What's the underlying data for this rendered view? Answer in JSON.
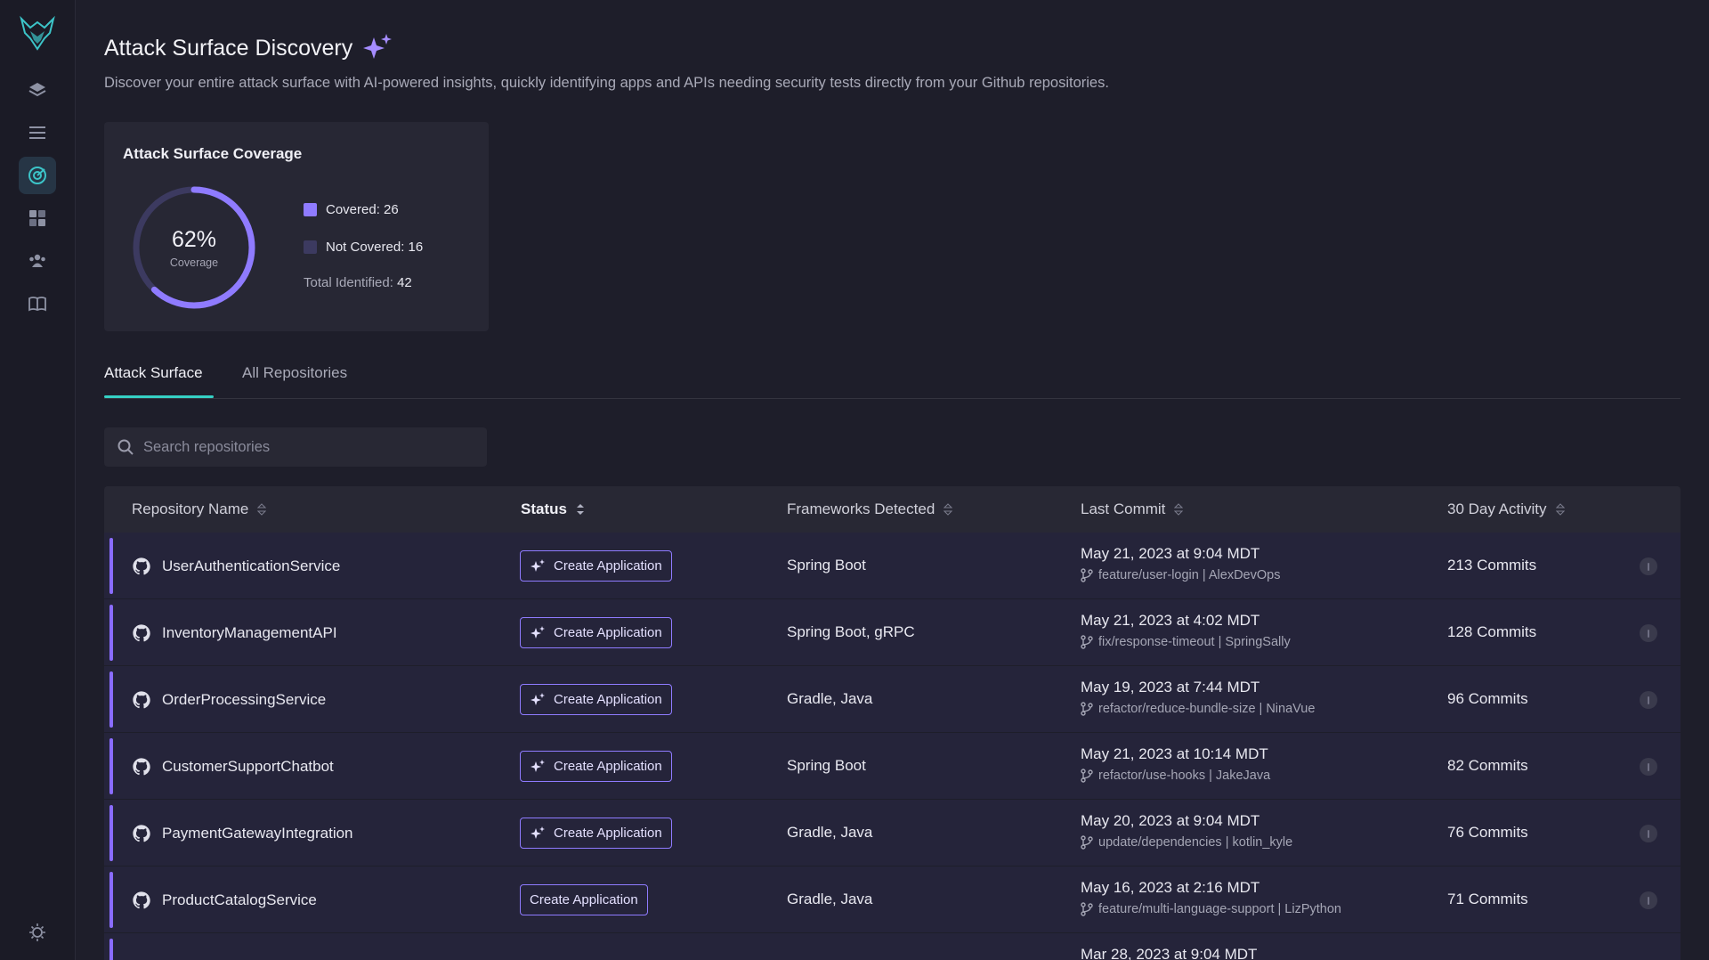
{
  "page": {
    "title": "Attack Surface Discovery",
    "subtitle": "Discover your entire attack surface with AI-powered insights, quickly identifying apps and APIs needing security tests directly from your Github repositories."
  },
  "sidebar": {
    "items": [
      {
        "icon": "layers-icon"
      },
      {
        "icon": "menu-icon"
      },
      {
        "icon": "radar-icon",
        "active": true
      },
      {
        "icon": "dashboard-icon"
      },
      {
        "icon": "users-icon"
      },
      {
        "icon": "book-icon"
      }
    ],
    "bottom_icon": "sun-icon"
  },
  "coverage": {
    "title": "Attack Surface Coverage",
    "percent": "62%",
    "percent_value": 62,
    "label": "Coverage",
    "covered_label": "Covered: 26",
    "not_covered_label": "Not Covered: 16",
    "total_label": "Total Identified:",
    "total_value": "42",
    "colors": {
      "covered": "#8f7bff",
      "not_covered": "#3c3a60"
    }
  },
  "tabs": [
    {
      "label": "Attack Surface",
      "active": true
    },
    {
      "label": "All Repositories",
      "active": false
    }
  ],
  "search": {
    "placeholder": "Search repositories"
  },
  "table": {
    "columns": [
      "Repository Name",
      "Status",
      "Frameworks Detected",
      "Last Commit",
      "30 Day Activity"
    ],
    "rows": [
      {
        "name": "UserAuthenticationService",
        "button": "Create Application",
        "ai": true,
        "frameworks": "Spring Boot",
        "date": "May 21, 2023 at 9:04 MDT",
        "branch": "feature/user-login | AlexDevOps",
        "activity": "213 Commits"
      },
      {
        "name": "InventoryManagementAPI",
        "button": "Create Application",
        "ai": true,
        "frameworks": "Spring Boot, gRPC",
        "date": "May 21, 2023 at 4:02 MDT",
        "branch": "fix/response-timeout | SpringSally",
        "activity": "128 Commits"
      },
      {
        "name": "OrderProcessingService",
        "button": "Create Application",
        "ai": true,
        "frameworks": "Gradle, Java",
        "date": "May 19, 2023 at 7:44 MDT",
        "branch": "refactor/reduce-bundle-size | NinaVue",
        "activity": "96 Commits"
      },
      {
        "name": "CustomerSupportChatbot",
        "button": "Create Application",
        "ai": true,
        "frameworks": "Spring Boot",
        "date": "May 21, 2023 at 10:14 MDT",
        "branch": "refactor/use-hooks | JakeJava",
        "activity": "82 Commits"
      },
      {
        "name": "PaymentGatewayIntegration",
        "button": "Create Application",
        "ai": true,
        "frameworks": "Gradle, Java",
        "date": "May 20, 2023 at 9:04 MDT",
        "branch": "update/dependencies | kotlin_kyle",
        "activity": "76 Commits"
      },
      {
        "name": "ProductCatalogService",
        "button": "Create Application",
        "ai": false,
        "frameworks": "Gradle, Java",
        "date": "May 16, 2023 at 2:16 MDT",
        "branch": "feature/multi-language-support | LizPython",
        "activity": "71 Commits"
      },
      {
        "name": "",
        "button": "",
        "ai": false,
        "frameworks": "",
        "date": "Mar 28, 2023 at 9:04 MDT",
        "branch": "",
        "activity": ""
      }
    ]
  }
}
